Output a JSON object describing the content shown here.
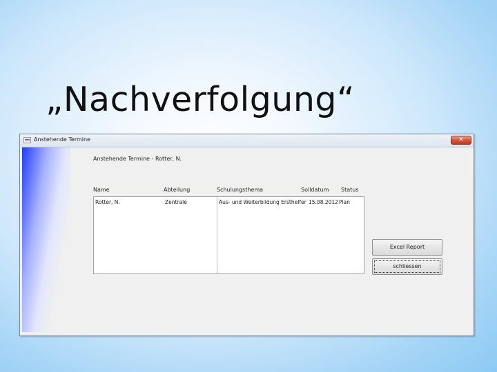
{
  "slide": {
    "title": "„Nachverfolgung“"
  },
  "window": {
    "title": "Anstehende Termine",
    "close_glyph": "✕",
    "heading": "Anstehende Termine - Rotter, N.",
    "columns": [
      "Name",
      "Abteilung",
      "Schulungsthema",
      "Solldatum",
      "Status"
    ],
    "rows": [
      {
        "name": "Rotter, N.",
        "abteilung": "Zentrale",
        "schulungsthema": "Aus- und Weiterbildung Ersthelfer",
        "solldatum": "15.08.2012",
        "status": "Plan"
      }
    ],
    "buttons": {
      "excel": "Excel Report",
      "close": "schliessen"
    }
  }
}
